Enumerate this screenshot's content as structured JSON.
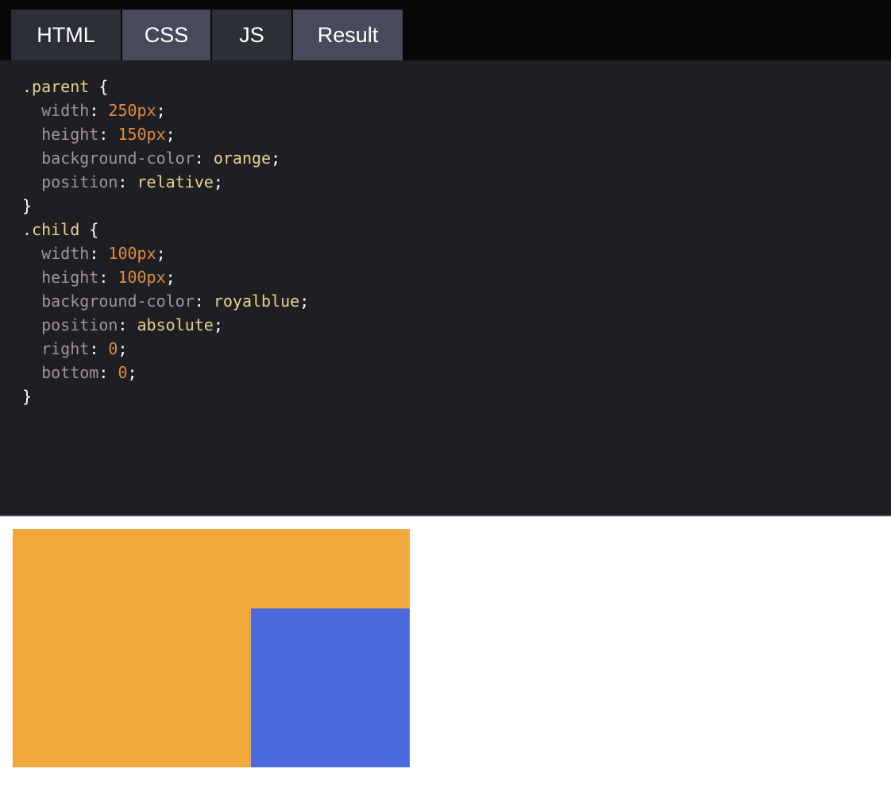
{
  "tabs": {
    "html": "HTML",
    "css": "CSS",
    "js": "JS",
    "result": "Result"
  },
  "code": {
    "l1_selector": ".parent",
    "l1_brace": " {",
    "l2_prop": "width",
    "l2_value": "250px",
    "l3_prop": "height",
    "l3_value": "150px",
    "l4_prop": "background-color",
    "l4_value": "orange",
    "l5_prop": "position",
    "l5_value": "relative",
    "l6_brace": "}",
    "l7_selector": ".child",
    "l7_brace": " {",
    "l8_prop": "width",
    "l8_value": "100px",
    "l9_prop": "height",
    "l9_value": "100px",
    "l10_prop": "background-color",
    "l10_value": "royalblue",
    "l11_prop": "position",
    "l11_value": "absolute",
    "l12_prop": "right",
    "l12_value": "0",
    "l13_prop": "bottom",
    "l13_value": "0",
    "l14_brace": "}"
  },
  "colors": {
    "parent": "#f0a83b",
    "child": "#4b6bdd",
    "editor_bg": "#1e1f23",
    "tab_active": "#464a5a",
    "tab_inactive": "#2d2f37"
  }
}
